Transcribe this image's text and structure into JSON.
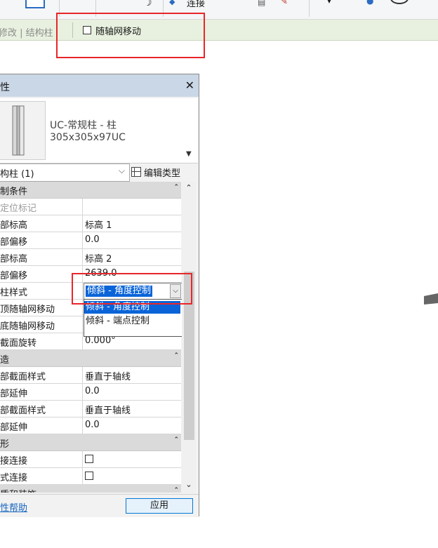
{
  "ribbon": {
    "connect_label": "连接",
    "icons": [
      "tool-icon",
      "tool-icon",
      "moon-icon",
      "connect-icon",
      "view-icon",
      "brush-icon",
      "dropdown-icon",
      "info-icon",
      "help-icon"
    ]
  },
  "options_bar": {
    "mode_label": "修改 | 结构柱",
    "move_with_grids_label": "随轴网移动",
    "move_with_grids_checked": false
  },
  "properties": {
    "title": "性",
    "type_name_line1": "UC-常规柱 - 柱",
    "type_name_line2": "305x305x97UC",
    "instance_filter": "构柱 (1)",
    "edit_type_label": "编辑类型",
    "groups": [
      {
        "title": "制条件",
        "rows": [
          {
            "name": "定位标记",
            "value": ""
          },
          {
            "name": "部标高",
            "value": "标高 1"
          },
          {
            "name": "部偏移",
            "value": "0.0"
          },
          {
            "name": "部标高",
            "value": "标高 2"
          },
          {
            "name": "部偏移",
            "value": "2639.0"
          },
          {
            "name": "柱样式",
            "value": ""
          },
          {
            "name": "顶随轴网移动",
            "value": ""
          },
          {
            "name": "底随轴网移动",
            "value": ""
          },
          {
            "name": "截面旋转",
            "value": "0.000°"
          }
        ]
      },
      {
        "title": "造",
        "rows": [
          {
            "name": "部截面样式",
            "value": "垂直于轴线"
          },
          {
            "name": "部延伸",
            "value": "0.0"
          },
          {
            "name": "部截面样式",
            "value": "垂直于轴线"
          },
          {
            "name": "部延伸",
            "value": "0.0"
          }
        ]
      },
      {
        "title": "形",
        "rows": [
          {
            "name": "接连接",
            "value": ""
          },
          {
            "name": "式连接",
            "value": ""
          }
        ]
      },
      {
        "title": "质和装饰",
        "rows": []
      }
    ],
    "column_style": {
      "current": "倾斜 - 角度控制",
      "options": [
        "倾斜 - 角度控制",
        "倾斜 - 端点控制"
      ]
    },
    "help_link": "性帮助",
    "apply_label": "应用"
  }
}
